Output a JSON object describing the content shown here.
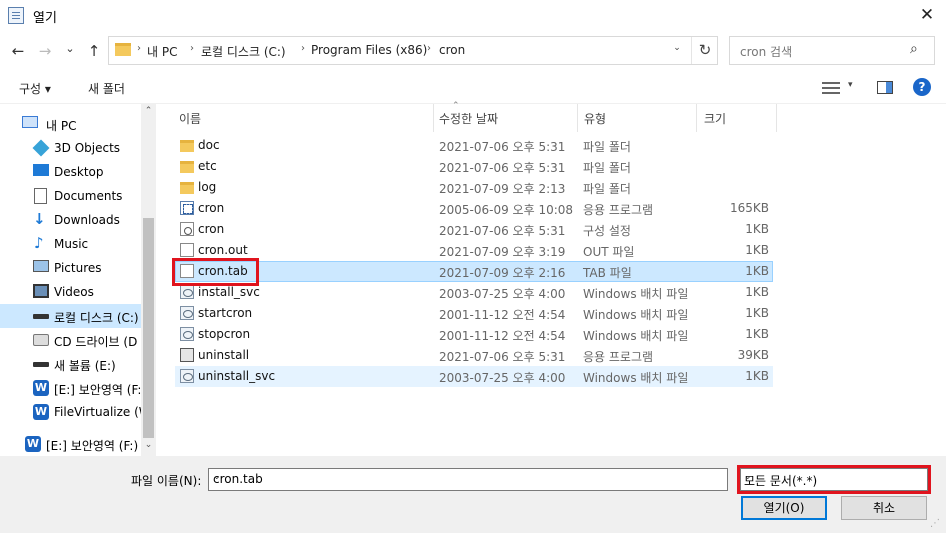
{
  "window": {
    "title": "열기",
    "close": "✕"
  },
  "nav": {
    "back": "←",
    "forward": "→",
    "recent": "⌄",
    "up": "↑"
  },
  "address": {
    "crumbs": [
      "내 PC",
      "로컬 디스크 (C:)",
      "Program Files (x86)",
      "cron"
    ],
    "separator": "›",
    "dropdown": "⌄",
    "refresh": "↻"
  },
  "search": {
    "placeholder": "cron 검색",
    "icon": "⌕"
  },
  "toolbar": {
    "organize": "구성 ▾",
    "new_folder": "새 폴더",
    "view_dropdown": "▾",
    "help": "?"
  },
  "sidebar": {
    "up_arrow": "⌃",
    "down_arrow": "⌄",
    "items": [
      {
        "label": "내 PC",
        "icon": "pc-icon"
      },
      {
        "label": "3D Objects",
        "icon": "cube-icon"
      },
      {
        "label": "Desktop",
        "icon": "desktop-icon"
      },
      {
        "label": "Documents",
        "icon": "documents-icon"
      },
      {
        "label": "Downloads",
        "icon": "download-icon"
      },
      {
        "label": "Music",
        "icon": "music-icon"
      },
      {
        "label": "Pictures",
        "icon": "pictures-icon"
      },
      {
        "label": "Videos",
        "icon": "videos-icon"
      },
      {
        "label": "로컬 디스크 (C:)",
        "icon": "drive-icon",
        "selected": true
      },
      {
        "label": "CD 드라이브 (D",
        "icon": "cd-drive-icon"
      },
      {
        "label": "새 볼륨 (E:)",
        "icon": "drive-icon"
      },
      {
        "label": "[E:] 보안영역 (F:",
        "icon": "w-app-icon"
      },
      {
        "label": "FileVirtualize (W",
        "icon": "w-app-icon"
      },
      {
        "label": "[E:] 보안영역 (F:)",
        "icon": "w-app-icon"
      }
    ]
  },
  "columns": {
    "name": "이름",
    "date": "수정한 날짜",
    "type": "유형",
    "size": "크기",
    "sort": "⌃"
  },
  "files": [
    {
      "name": "doc",
      "date": "2021-07-06 오후 5:31",
      "type": "파일 폴더",
      "size": "",
      "icon": "folder-icon"
    },
    {
      "name": "etc",
      "date": "2021-07-06 오후 5:31",
      "type": "파일 폴더",
      "size": "",
      "icon": "folder-icon"
    },
    {
      "name": "log",
      "date": "2021-07-09 오후 2:13",
      "type": "파일 폴더",
      "size": "",
      "icon": "folder-icon"
    },
    {
      "name": "cron",
      "date": "2005-06-09 오후 10:08",
      "type": "응용 프로그램",
      "size": "165KB",
      "icon": "exe-icon"
    },
    {
      "name": "cron",
      "date": "2021-07-06 오후 5:31",
      "type": "구성 설정",
      "size": "1KB",
      "icon": "config-icon"
    },
    {
      "name": "cron.out",
      "date": "2021-07-09 오후 3:19",
      "type": "OUT 파일",
      "size": "1KB",
      "icon": "file-icon"
    },
    {
      "name": "cron.tab",
      "date": "2021-07-09 오후 2:16",
      "type": "TAB 파일",
      "size": "1KB",
      "icon": "file-icon",
      "selected": true
    },
    {
      "name": "install_svc",
      "date": "2003-07-25 오후 4:00",
      "type": "Windows 배치 파일",
      "size": "1KB",
      "icon": "batch-icon"
    },
    {
      "name": "startcron",
      "date": "2001-11-12 오전 4:54",
      "type": "Windows 배치 파일",
      "size": "1KB",
      "icon": "batch-icon"
    },
    {
      "name": "stopcron",
      "date": "2001-11-12 오전 4:54",
      "type": "Windows 배치 파일",
      "size": "1KB",
      "icon": "batch-icon"
    },
    {
      "name": "uninstall",
      "date": "2021-07-06 오후 5:31",
      "type": "응용 프로그램",
      "size": "39KB",
      "icon": "setup-icon"
    },
    {
      "name": "uninstall_svc",
      "date": "2003-07-25 오후 4:00",
      "type": "Windows 배치 파일",
      "size": "1KB",
      "icon": "batch-icon",
      "hover": true
    }
  ],
  "footer": {
    "filename_label": "파일 이름(N):",
    "filename_value": "cron.tab",
    "filename_dropdown": "⌄",
    "filetype_value": "모든 문서(*.*)",
    "filetype_dropdown": "⌄",
    "open_label": "열기(O)",
    "cancel_label": "취소",
    "grip": "⋰"
  },
  "colors": {
    "selection": "#cce8ff",
    "highlight": "#e0141e",
    "accent": "#0078d7"
  }
}
